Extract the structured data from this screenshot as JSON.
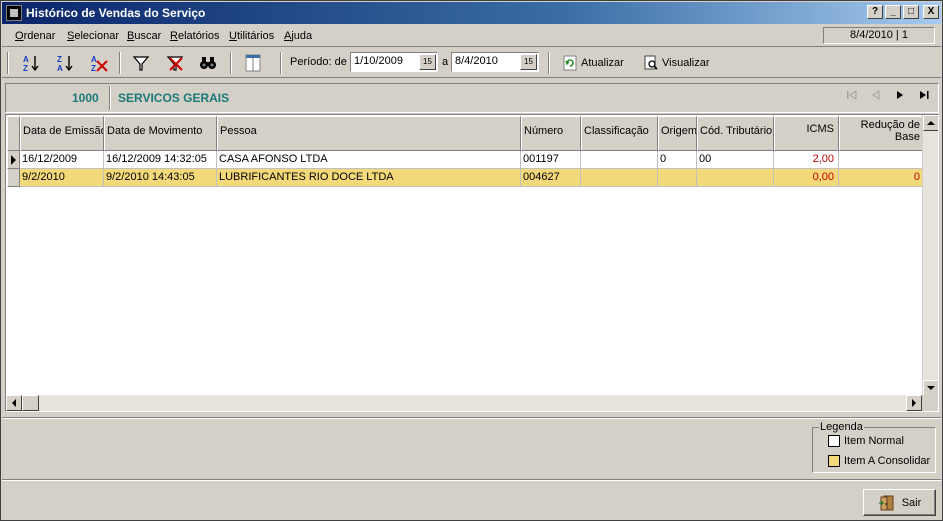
{
  "window": {
    "title": "Histórico de Vendas do Serviço",
    "controls": [
      "?",
      "_",
      "□",
      "X"
    ]
  },
  "menu": {
    "items": [
      {
        "label": "Ordenar",
        "mnemonic": "O"
      },
      {
        "label": "Selecionar",
        "mnemonic": "S"
      },
      {
        "label": "Buscar",
        "mnemonic": "B"
      },
      {
        "label": "Relatórios",
        "mnemonic": "R"
      },
      {
        "label": "Utilitários",
        "mnemonic": "U"
      },
      {
        "label": "Ajuda",
        "mnemonic": "A"
      }
    ],
    "status": "8/4/2010 | 1"
  },
  "toolbar": {
    "period_label": "Período: de",
    "date_from": "1/10/2009",
    "to_label": "a",
    "date_to": "8/4/2010",
    "calendar_glyph": "15",
    "refresh_label": "Atualizar",
    "view_label": "Visualizar"
  },
  "header": {
    "code": "1000",
    "name": "SERVICOS GERAIS"
  },
  "grid": {
    "columns": [
      "Data de Emissão",
      "Data de Movimento",
      "Pessoa",
      "Número",
      "Classificação",
      "Origem",
      "Cód. Tributário",
      "ICMS",
      "Redução de Base"
    ],
    "rows": [
      {
        "emissao": "16/12/2009",
        "movimento": "16/12/2009 14:32:05",
        "pessoa": "CASA AFONSO LTDA",
        "numero": "001197",
        "classificacao": "",
        "origem": "0",
        "cod_tributario": "00",
        "icms": "2,00",
        "reducao": "",
        "status": "normal"
      },
      {
        "emissao": "9/2/2010",
        "movimento": "9/2/2010 14:43:05",
        "pessoa": "LUBRIFICANTES RIO DOCE LTDA",
        "numero": "004627",
        "classificacao": "",
        "origem": "",
        "cod_tributario": "",
        "icms": "0,00",
        "reducao": "0",
        "status": "consolidar"
      }
    ]
  },
  "legend": {
    "title": "Legenda",
    "items": [
      {
        "label": "Item Normal",
        "color": "#ffffff"
      },
      {
        "label": "Item A Consolidar",
        "color": "#f4d97a"
      }
    ]
  },
  "footer": {
    "exit_label": "Sair"
  }
}
